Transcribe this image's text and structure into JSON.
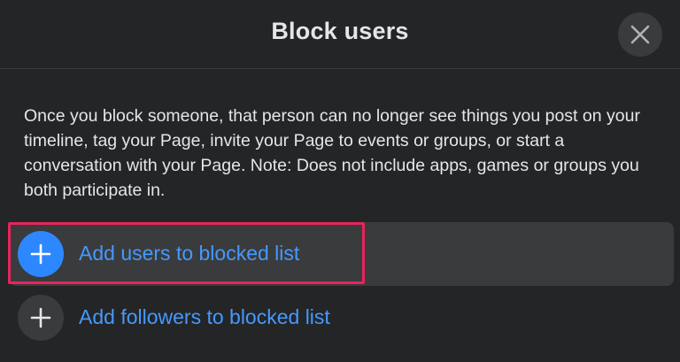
{
  "dialog": {
    "title": "Block users",
    "description": "Once you block someone, that person can no longer see things you post on your timeline, tag your Page, invite your Page to events or groups, or start a conversation with your Page. Note: Does not include apps, games or groups you both participate in.",
    "actions": [
      {
        "label": "Add users to blocked list",
        "icon": "plus-icon",
        "highlighted": true
      },
      {
        "label": "Add followers to blocked list",
        "icon": "plus-icon",
        "highlighted": false
      }
    ]
  },
  "colors": {
    "background": "#242526",
    "text": "#e4e6eb",
    "link": "#4599ff",
    "accent_circle": "#2d88ff",
    "highlight_border": "#e8245c"
  }
}
